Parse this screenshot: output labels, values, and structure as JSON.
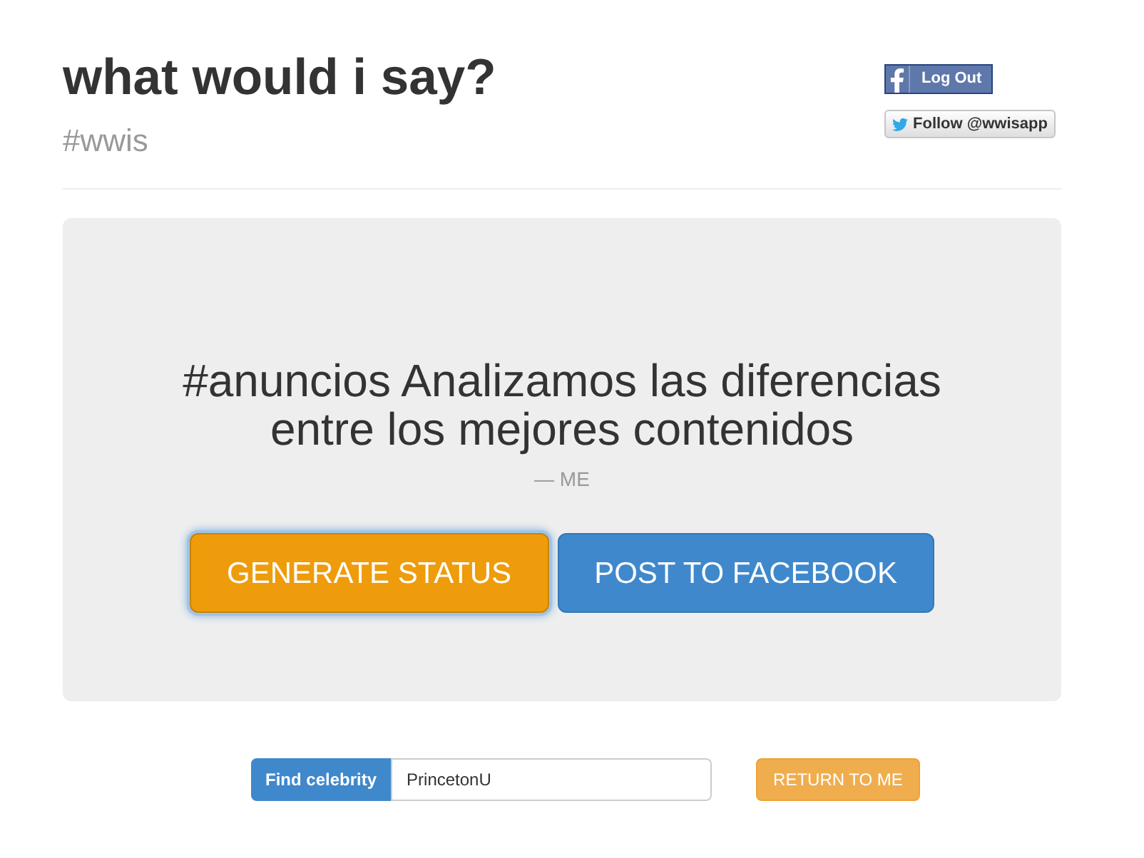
{
  "header": {
    "title": "what would i say?",
    "subtitle": "#wwis"
  },
  "social": [
    {
      "kind": "facebook",
      "label": "Log Out"
    },
    {
      "kind": "twitter",
      "label": "Follow @wwisapp"
    }
  ],
  "status": {
    "text": "#anuncios Analizamos las diferencias entre los mejores contenidos",
    "attribution": "— ME"
  },
  "actions": [
    {
      "label": "GENERATE STATUS",
      "kind": "warning",
      "focused": true
    },
    {
      "label": "POST TO FACEBOOK",
      "kind": "primary",
      "focused": false
    }
  ],
  "search": {
    "label": "Find celebrity",
    "value": "PrincetonU"
  },
  "return_button": {
    "label": "RETURN TO ME"
  }
}
